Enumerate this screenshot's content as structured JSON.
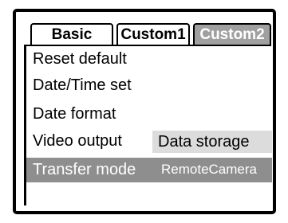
{
  "tabs": [
    {
      "label": "Basic",
      "active": false
    },
    {
      "label": "Custom1",
      "active": false
    },
    {
      "label": "Custom2",
      "active": true
    }
  ],
  "menu": {
    "items": [
      {
        "label": "Reset default",
        "value": ""
      },
      {
        "label": "Date/Time set",
        "value": ""
      },
      {
        "label": "Date format",
        "value": ""
      },
      {
        "label": "Video output",
        "value": "Data storage"
      },
      {
        "label": "Transfer mode",
        "value": "RemoteCamera",
        "selected": true
      }
    ]
  },
  "colors": {
    "active_tab_bg": "#a0a0a0",
    "selected_row_bg": "#8e8e8e",
    "value_box_bg": "#dcdcdc",
    "border": "#000000"
  }
}
